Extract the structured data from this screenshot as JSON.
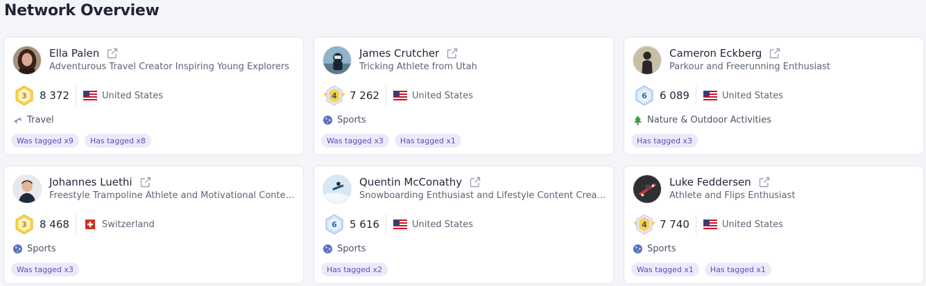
{
  "page": {
    "title": "Network Overview"
  },
  "colors": {
    "tag_bg": "#ece9fb",
    "tag_text": "#5b4fb0",
    "card_border": "#e3e6ee"
  },
  "profiles": [
    {
      "name": "Ella Palen",
      "headline": "Adventurous Travel Creator Inspiring Young Explorers",
      "rank": "3",
      "rank_style": "gold-hexagon",
      "count": "8 372",
      "country": "United States",
      "flag": "us-flag-icon",
      "category": "Travel",
      "category_icon": "airplane-icon",
      "tags": [
        "Was tagged x9",
        "Has tagged x8"
      ],
      "avatar": "dark-hair-portrait"
    },
    {
      "name": "James Crutcher",
      "headline": "Tricking Athlete from Utah",
      "rank": "4",
      "rank_style": "winged-gold-hexagon",
      "count": "7 262",
      "country": "United States",
      "flag": "us-flag-icon",
      "category": "Sports",
      "category_icon": "globe-icon",
      "tags": [
        "Was tagged x3",
        "Has tagged x1"
      ],
      "avatar": "outdoor-portrait"
    },
    {
      "name": "Cameron Eckberg",
      "headline": "Parkour and Freerunning Enthusiast",
      "rank": "6",
      "rank_style": "blue-hexagon",
      "count": "6 089",
      "country": "United States",
      "flag": "us-flag-icon",
      "category": "Nature & Outdoor Activities",
      "category_icon": "tree-icon",
      "tags": [
        "Has tagged x3"
      ],
      "avatar": "silhouette-portrait"
    },
    {
      "name": "Johannes Luethi",
      "headline": "Freestyle Trampoline Athlete and Motivational Content Creator",
      "rank": "3",
      "rank_style": "gold-hexagon",
      "count": "8 468",
      "country": "Switzerland",
      "flag": "swiss-flag-icon",
      "category": "Sports",
      "category_icon": "globe-icon",
      "tags": [
        "Was tagged x3"
      ],
      "avatar": "smiling-portrait"
    },
    {
      "name": "Quentin McConathy",
      "headline": "Snowboarding Enthusiast and Lifestyle Content Creator",
      "rank": "6",
      "rank_style": "blue-hexagon",
      "count": "5 616",
      "country": "United States",
      "flag": "us-flag-icon",
      "category": "Sports",
      "category_icon": "globe-icon",
      "tags": [
        "Has tagged x2"
      ],
      "avatar": "snowboard-jump-portrait"
    },
    {
      "name": "Luke Feddersen",
      "headline": "Athlete and Flips Enthusiast",
      "rank": "4",
      "rank_style": "winged-gold-hexagon",
      "count": "7 740",
      "country": "United States",
      "flag": "us-flag-icon",
      "category": "Sports",
      "category_icon": "globe-icon",
      "tags": [
        "Was tagged x1",
        "Has tagged x1"
      ],
      "avatar": "skateboard-portrait"
    }
  ]
}
